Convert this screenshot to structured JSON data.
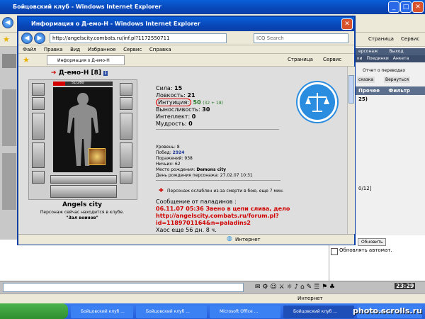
{
  "main_window": {
    "title": "Бойцовский клуб - Windows Internet Explorer"
  },
  "popup": {
    "title": "Информация о Д-емо-Н - Windows Internet Explorer",
    "address": "http://angelscity.combats.ru/inf.pl?1172550711",
    "search_placeholder": "ICQ Search",
    "menu": [
      "Файл",
      "Правка",
      "Вид",
      "Избранное",
      "Сервис",
      "Справка"
    ],
    "tab_title": "Информация о Д-емо-Н",
    "toolbar_page": "Страница",
    "toolbar_service": "Сервис",
    "status_zone": "Интернет"
  },
  "character": {
    "name": "Д-емо-Н",
    "level": "[8]",
    "hp": "51/260",
    "city": "Angels city",
    "location_text": "Персонаж сейчас находится в клубе.",
    "room": "\"Зал воинов\"",
    "stats": {
      "strength_label": "Сила:",
      "strength": "15",
      "agility_label": "Ловкость:",
      "agility": "21",
      "intuition_label": "Интуиция:",
      "intuition": "50",
      "intuition_bonus": "(32 + 18)",
      "endurance_label": "Выносливость:",
      "endurance": "30",
      "intellect_label": "Интеллект:",
      "intellect": "0",
      "wisdom_label": "Мудрость:",
      "wisdom": "0"
    },
    "info": {
      "level": "Уровень: 8",
      "wins_label": "Побед:",
      "wins": "2924",
      "losses": "Поражений: 938",
      "draws": "Ничьих: 62",
      "birthplace_label": "Место рождения:",
      "birthplace": "Demons city",
      "birthday": "День рождения персонажа: 27.02.07 10:31"
    },
    "weakened": "Персонаж ослаблен из-за смерти в бою, еще 7 мин.",
    "paladin_header": "Сообщение от паладинов :",
    "paladin_line1": "06.11.07 05:36 Звено в цепи слива, дело",
    "paladin_line2": "http://angelscity.combats.ru/forum.pl?",
    "paladin_line3": "id=1189701164&n=paladins2",
    "chaos": "Хаос еще 56 дн. 8 ч."
  },
  "right_panel": {
    "tabs": [
      "ерсонаж",
      "Выход"
    ],
    "tabs2": [
      "ки",
      "Поединки",
      "Анкета"
    ],
    "report": "Отчет о переводах",
    "hint": "сказка",
    "back": "Вернуться",
    "other": "Прочее",
    "filter": "Фильтр",
    "count": "25)",
    "pager": "0/12]",
    "refresh": "Обновить",
    "auto_refresh": "Обновлять автомат."
  },
  "main_toolbar": {
    "page": "Страница",
    "service": "Сервис"
  },
  "clock": "23:29",
  "taskbar": [
    "Бойцовский клуб ...",
    "Бойцовский клуб ...",
    "Microsoft Office ...",
    "Бойцовский клуб ...",
    "Бойцовский клуб ..."
  ],
  "status_main": "Интернет",
  "watermark": "photo.scrolls.ru",
  "colors": {
    "title_blue": "#0846b8",
    "taskbar_blue": "#245edb",
    "paladin_red": "#d00000",
    "seal_blue": "#2a8de0"
  }
}
